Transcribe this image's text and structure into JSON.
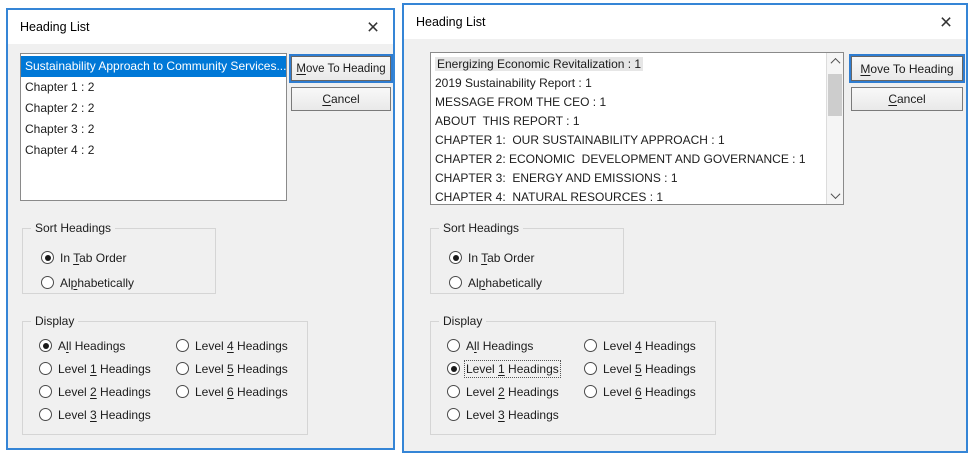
{
  "colors": {
    "dialog_border": "#3585d6",
    "selection_blue": "#0078d7",
    "inactive_selection_gray": "#e6e6e6",
    "titlebar_bg": "#ffffff",
    "dialog_bg": "#f0f0f0"
  },
  "controls": {
    "close_glyph": "×",
    "move_button": {
      "pre": "",
      "key": "M",
      "post": "ove To Heading"
    },
    "cancel_button": {
      "pre": "",
      "key": "C",
      "post": "ancel"
    },
    "sort_group_label": "Sort Headings",
    "display_group_label": "Display",
    "sort_options": {
      "in_tab_order": {
        "pre": "In ",
        "key": "T",
        "post": "ab Order"
      },
      "alphabetically": {
        "pre": "Al",
        "key": "p",
        "post": "habetically"
      }
    },
    "display_options": {
      "all": {
        "pre": "A",
        "key": "l",
        "post": "l Headings"
      },
      "level1": {
        "pre": "Level ",
        "key": "1",
        "post": " Headings"
      },
      "level2": {
        "pre": "Level ",
        "key": "2",
        "post": " Headings"
      },
      "level3": {
        "pre": "Level ",
        "key": "3",
        "post": " Headings"
      },
      "level4": {
        "pre": "Level ",
        "key": "4",
        "post": " Headings"
      },
      "level5": {
        "pre": "Level ",
        "key": "5",
        "post": " Headings"
      },
      "level6": {
        "pre": "Level ",
        "key": "6",
        "post": " Headings"
      }
    }
  },
  "left_dialog": {
    "title": "Heading List",
    "list_items": [
      "Sustainability Approach to Community Services...",
      "Chapter 1 : 2",
      "Chapter 2 : 2",
      "Chapter 3 : 2",
      "Chapter 4 : 2"
    ],
    "selected_item": "Sustainability Approach to Community Services...",
    "sort_selected": "In Tab Order",
    "display_selected": "All Headings"
  },
  "right_dialog": {
    "title": "Heading List",
    "list_items": [
      "Energizing Economic Revitalization : 1",
      "2019 Sustainability Report : 1",
      "MESSAGE FROM THE CEO : 1",
      "ABOUT  THIS REPORT : 1",
      "CHAPTER 1:  OUR SUSTAINABILITY APPROACH : 1",
      "CHAPTER 2: ECONOMIC  DEVELOPMENT AND GOVERNANCE : 1",
      "CHAPTER 3:  ENERGY AND EMISSIONS : 1",
      "CHAPTER 4:  NATURAL RESOURCES : 1"
    ],
    "selected_item": "Energizing Economic Revitalization : 1",
    "sort_selected": "In Tab Order",
    "display_selected": "Level 1 Headings",
    "scrollbar_visible": true
  }
}
